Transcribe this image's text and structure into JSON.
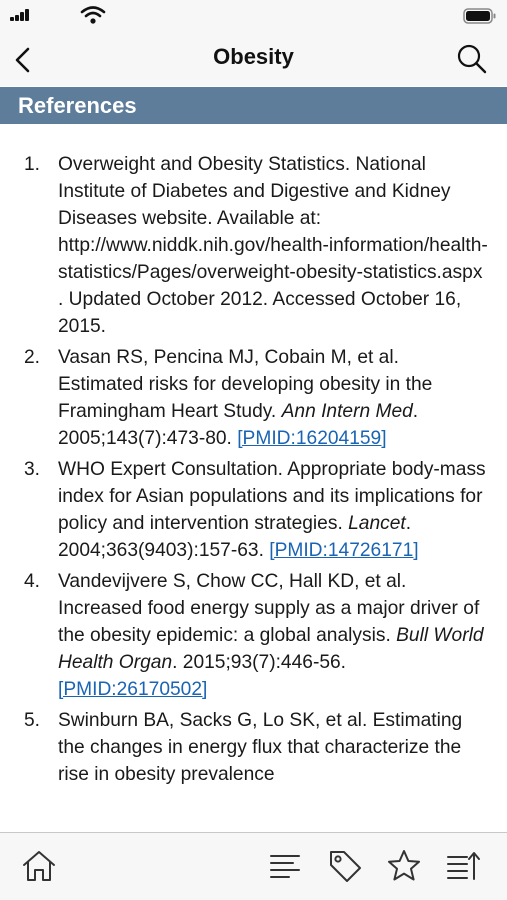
{
  "nav": {
    "title": "Obesity"
  },
  "section": {
    "title": "References"
  },
  "references": [
    {
      "number": "1.",
      "text": "Overweight and Obesity Statistics. National Institute of Diabetes and Digestive and Kidney Diseases website. Available at: http://www.niddk.nih.gov/health-information/health-statistics/Pages/overweight-obesity-statistics.aspx . Updated October 2012. Accessed October 16, 2015.",
      "journal": "",
      "after": "",
      "pmid": ""
    },
    {
      "number": "2.",
      "text": "Vasan RS, Pencina MJ, Cobain M, et al. Estimated risks for developing obesity in the Framingham Heart Study. ",
      "journal": "Ann Intern Med",
      "after": ". 2005;143(7):473-80. ",
      "pmid": "[PMID:16204159]"
    },
    {
      "number": "3.",
      "text": "WHO Expert Consultation. Appropriate body-mass index for Asian populations and its implications for policy and intervention strategies. ",
      "journal": "Lancet",
      "after": ". 2004;363(9403):157-63. ",
      "pmid": "[PMID:14726171]"
    },
    {
      "number": "4.",
      "text": "Vandevijvere S, Chow CC, Hall KD, et al. Increased food energy supply as a major driver of the obesity epidemic: a global analysis. ",
      "journal": "Bull World Health Organ",
      "after": ". 2015;93(7):446-56. ",
      "pmid": "[PMID:26170502]"
    },
    {
      "number": "5.",
      "text": "Swinburn BA, Sacks G, Lo SK, et al. Estimating the changes in energy flux that characterize the rise in obesity prevalence",
      "journal": "",
      "after": "",
      "pmid": ""
    }
  ],
  "icons": {
    "back": "chevron-left-icon",
    "search": "search-icon",
    "home": "home-icon",
    "outline": "outline-icon",
    "tag": "tag-icon",
    "favorite": "star-icon",
    "collapse": "collapse-list-icon"
  },
  "colors": {
    "section_header": "#5d7d9a",
    "link": "#1a64b4",
    "bar_background": "#f7f7f7"
  }
}
